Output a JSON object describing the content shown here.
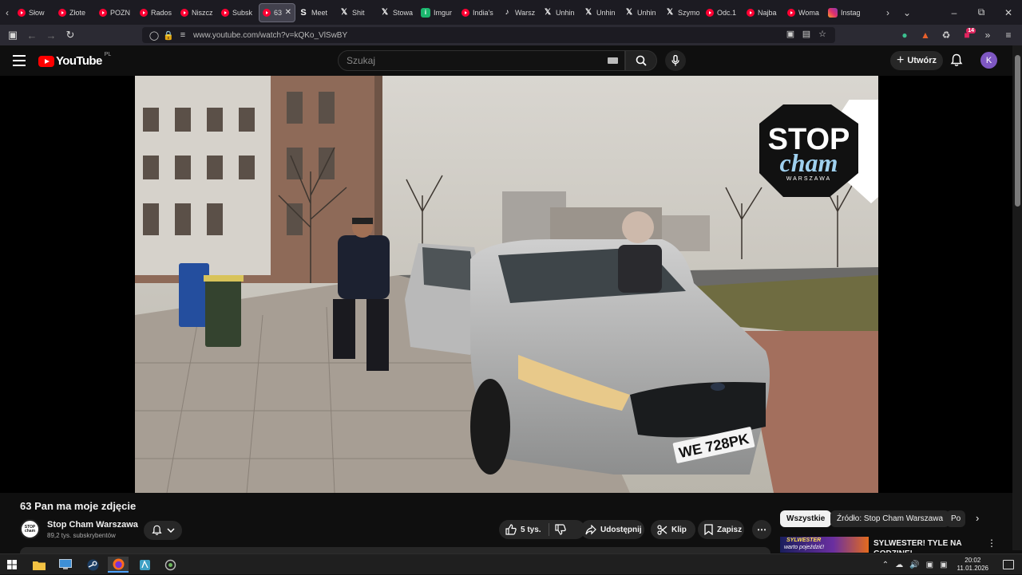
{
  "browser": {
    "tabs": [
      {
        "icon": "youtube-icon",
        "label": "Słow"
      },
      {
        "icon": "youtube-icon",
        "label": "Złote"
      },
      {
        "icon": "youtube-icon",
        "label": "POZN"
      },
      {
        "icon": "youtube-icon",
        "label": "Rados"
      },
      {
        "icon": "youtube-icon",
        "label": "Niszcz"
      },
      {
        "icon": "youtube-icon",
        "label": "Subsk"
      },
      {
        "icon": "youtube-icon",
        "label": "63",
        "active": true
      },
      {
        "icon": "s-icon",
        "label": "Meet"
      },
      {
        "icon": "x-icon",
        "label": "Shit"
      },
      {
        "icon": "x-icon",
        "label": "Stowa"
      },
      {
        "icon": "imgur-icon",
        "label": "Imgur"
      },
      {
        "icon": "youtube-icon",
        "label": "India's"
      },
      {
        "icon": "tiktok-icon",
        "label": "Warsz"
      },
      {
        "icon": "x-icon",
        "label": "Unhin"
      },
      {
        "icon": "x-icon",
        "label": "Unhin"
      },
      {
        "icon": "x-icon",
        "label": "Unhin"
      },
      {
        "icon": "x-icon",
        "label": "Szymo"
      },
      {
        "icon": "youtube-icon",
        "label": "Odc.1"
      },
      {
        "icon": "youtube-icon",
        "label": "Najba"
      },
      {
        "icon": "youtube-icon",
        "label": "Woma"
      },
      {
        "icon": "instagram-icon",
        "label": "Instag"
      }
    ],
    "url": "www.youtube.com/watch?v=kQKo_VlSwBY",
    "ext_badge": "14"
  },
  "masthead": {
    "logo_text": "YouTube",
    "country": "PL",
    "search_placeholder": "Szukaj",
    "create_label": "Utwórz",
    "avatar_letter": "K"
  },
  "video": {
    "title": "63 Pan ma moje zdjęcie",
    "watermark_top": "STOP",
    "watermark_mid": "cham",
    "watermark_bottom": "WARSZAWA",
    "plate": "WE 728PK"
  },
  "channel": {
    "name": "Stop Cham Warszawa",
    "subscribers": "89,2 tys. subskrybentów",
    "avatar_text": "STOP cham"
  },
  "actions": {
    "likes": "5 tys.",
    "share": "Udostępnij",
    "clip": "Klip",
    "save": "Zapisz"
  },
  "chips": [
    "Wszystkie",
    "Źródło: Stop Cham Warszawa",
    "Po"
  ],
  "recommended": {
    "title": "SYLWESTER! TYLE NA GODZINĘ!",
    "thumb_line1": "SYLWESTER",
    "thumb_line2": "warto pojeździć!"
  },
  "taskbar": {
    "time": "20:02",
    "date": "11.01.2026"
  }
}
